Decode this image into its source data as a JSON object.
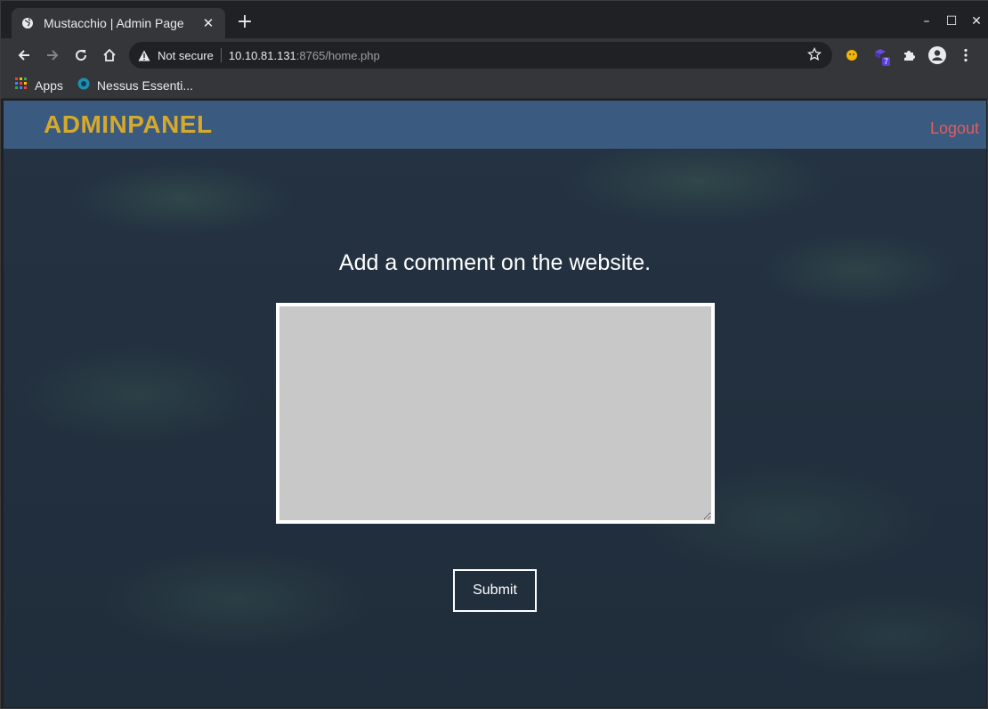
{
  "browser": {
    "tab": {
      "title": "Mustacchio | Admin Page",
      "favicon": "globe-icon",
      "close_label": "✕"
    },
    "new_tab_label": "+",
    "window_controls": {
      "minimize": "–",
      "maximize": "☐",
      "close": "✕"
    },
    "address_bar": {
      "security_text": "Not secure",
      "url_host": "10.10.81.131",
      "url_rest": ":8765/home.php"
    },
    "extensions": [
      {
        "name": "yellow-extension-icon"
      },
      {
        "name": "purple-extension-icon",
        "badge": "7"
      },
      {
        "name": "puzzle-extensions-icon"
      },
      {
        "name": "profile-icon"
      },
      {
        "name": "menu-kebab-icon"
      }
    ],
    "bookmarks": [
      {
        "label": "Apps",
        "icon": "apps-grid-icon"
      },
      {
        "label": "Nessus Essenti...",
        "icon": "nessus-icon"
      }
    ]
  },
  "page": {
    "brand": "ADMINPANEL",
    "logout_label": "Logout",
    "heading": "Add a comment on the website.",
    "comment": {
      "value": "",
      "placeholder": ""
    },
    "submit_label": "Submit"
  },
  "colors": {
    "navbar": "#3b5a80",
    "brand": "#d5a92c",
    "logout": "#e05d5d",
    "background": "#223040",
    "textarea": "#c8c8c8"
  }
}
